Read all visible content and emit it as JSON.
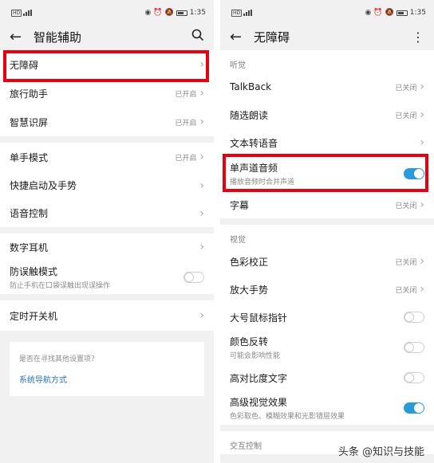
{
  "status": {
    "time": "1:35",
    "hd": "HD",
    "icons": [
      "eye-icon",
      "alarm-icon",
      "mute-icon"
    ]
  },
  "left": {
    "title": "智能辅助",
    "back_icon": "←",
    "search_icon": "search-icon",
    "rows": [
      {
        "label": "无障碍",
        "state": ""
      },
      {
        "label": "旅行助手",
        "state": "已开启"
      },
      {
        "label": "智慧识屏",
        "state": "已开启"
      },
      {
        "label": "单手模式",
        "state": "已开启"
      },
      {
        "label": "快捷启动及手势",
        "state": ""
      },
      {
        "label": "语音控制",
        "state": ""
      },
      {
        "label": "数字耳机",
        "state": ""
      },
      {
        "label": "防误触模式",
        "sub": "防止手机在口袋误触出现误操作"
      },
      {
        "label": "定时开关机",
        "state": ""
      }
    ],
    "search_prompt": "是否在寻找其他设置项？",
    "search_link": "系统导航方式"
  },
  "right": {
    "title": "无障碍",
    "back_icon": "←",
    "more_icon": "more-icon",
    "sections": {
      "hearing": "听觉",
      "vision": "视觉",
      "interaction": "交互控制"
    },
    "rows": [
      {
        "label": "TalkBack",
        "state": "已关闭"
      },
      {
        "label": "随选朗读",
        "state": "已关闭"
      },
      {
        "label": "文本转语音",
        "state": ""
      },
      {
        "label": "单声道音频",
        "sub": "播放音频时合并声道",
        "toggle": true
      },
      {
        "label": "字幕",
        "state": "已关闭"
      },
      {
        "label": "色彩校正",
        "state": "已关闭"
      },
      {
        "label": "放大手势",
        "state": "已关闭"
      },
      {
        "label": "大号鼠标指针",
        "toggle": false
      },
      {
        "label": "颜色反转",
        "sub": "可能会影响性能",
        "toggle": false
      },
      {
        "label": "高对比度文字",
        "toggle": false
      },
      {
        "label": "高级视觉效果",
        "sub": "色彩取色、模糊效果和光影错层效果",
        "toggle": true
      }
    ]
  },
  "watermark": "头条 @知识与技能",
  "colors": {
    "highlight": "#e60012",
    "toggle_on": "#2a9bd8"
  }
}
